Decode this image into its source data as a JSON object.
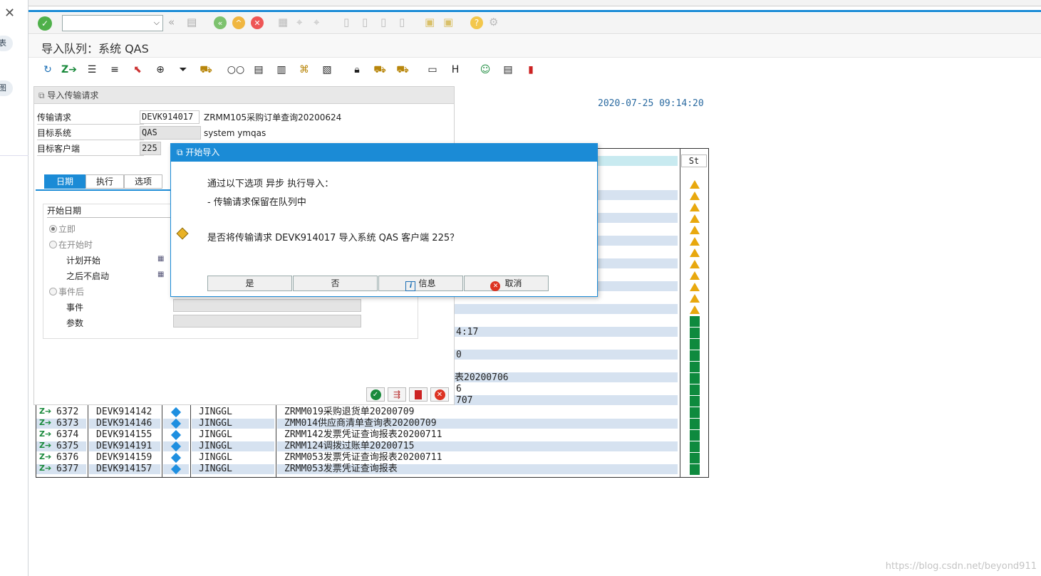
{
  "window": {
    "title": "导入队列：系统 QAS",
    "timestamp": "2020-07-25 09:14:20"
  },
  "left_strip": {
    "item1": "表",
    "item2": "图"
  },
  "panel": {
    "header": "导入传输请求",
    "fields": [
      {
        "label": "传输请求",
        "value": "DEVK914017",
        "desc": "ZRMM105采购订单查询20200624"
      },
      {
        "label": "目标系统",
        "value": "QAS",
        "desc": "system ymqas"
      },
      {
        "label": "目标客户端",
        "value": "225",
        "desc": ""
      }
    ],
    "tabs": [
      {
        "label": "日期",
        "active": true
      },
      {
        "label": "执行",
        "active": false
      },
      {
        "label": "选项",
        "active": false
      }
    ],
    "group": {
      "title": "开始日期",
      "radio_immediate": "立即",
      "radio_at_start": "在开始时",
      "planned_start": "计划开始",
      "no_start_after": "之后不启动",
      "radio_after_event": "事件后",
      "event_label": "事件",
      "param_label": "参数"
    }
  },
  "table": {
    "status_header": "St",
    "partial_cells": [
      "4:17",
      "0",
      "表20200706",
      "6",
      "707"
    ],
    "rows": [
      {
        "num": "6372",
        "request": "DEVK914142",
        "owner": "JINGGL",
        "desc": "ZRMM019采购退货单20200709"
      },
      {
        "num": "6373",
        "request": "DEVK914146",
        "owner": "JINGGL",
        "desc": "ZMM014供应商清单查询表20200709"
      },
      {
        "num": "6374",
        "request": "DEVK914155",
        "owner": "JINGGL",
        "desc": "ZRMM142发票凭证查询报表20200711"
      },
      {
        "num": "6375",
        "request": "DEVK914191",
        "owner": "JINGGL",
        "desc": "ZRMM124调拨过账单20200715"
      },
      {
        "num": "6376",
        "request": "DEVK914159",
        "owner": "JINGGL",
        "desc": "ZRMM053发票凭证查询报表20200711"
      },
      {
        "num": "6377",
        "request": "DEVK914157",
        "owner": "JINGGL",
        "desc": "ZRMM053发票凭证查询报表"
      }
    ]
  },
  "dialog": {
    "title": "开始导入",
    "line1": "通过以下选项 异步 执行导入：",
    "line2": "- 传输请求保留在队列中",
    "question": "是否将传输请求 DEVK914017 导入系统 QAS 客户端 225？",
    "buttons": {
      "yes": "是",
      "no": "否",
      "info": "信息",
      "cancel": "取消"
    }
  },
  "watermark": "https://blog.csdn.net/beyond911",
  "colors": {
    "accent": "#1b8bd6",
    "stripe": "#d6e2f0",
    "warning": "#e8a80e",
    "ok": "#0e8a3e"
  }
}
